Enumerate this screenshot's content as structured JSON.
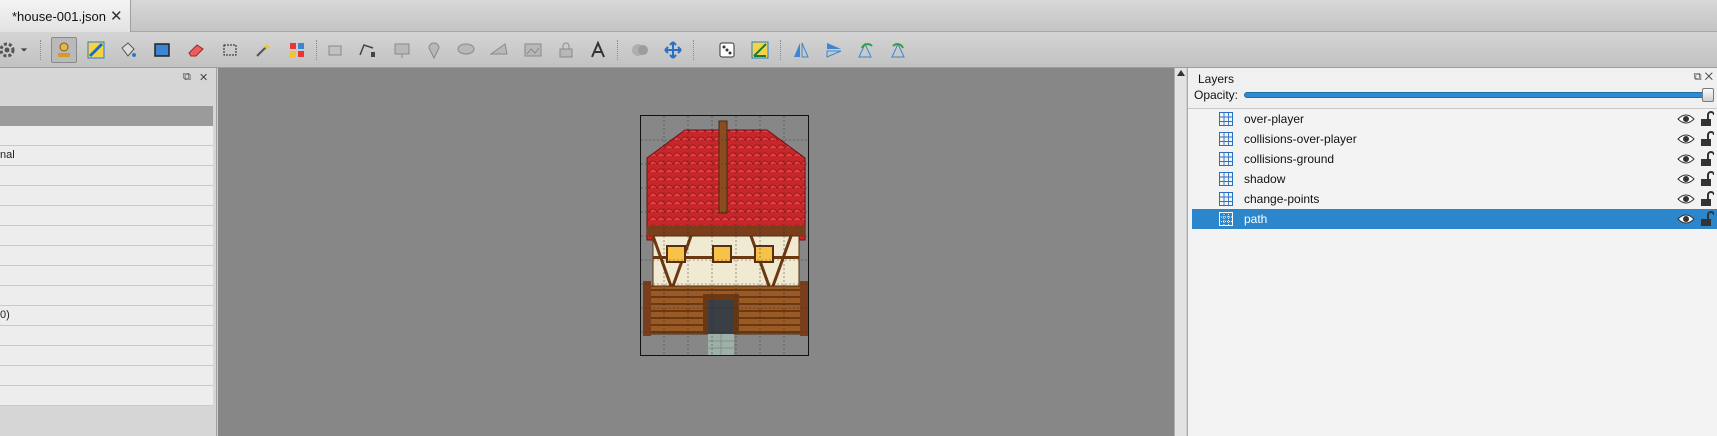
{
  "tabs": [
    {
      "label": "*house-001.json",
      "close": "✕"
    }
  ],
  "toolbar": {
    "tools": [
      "gear-icon",
      "stamp-brush-icon",
      "terrain-brush-icon",
      "bucket-fill-icon",
      "shape-fill-icon",
      "eraser-icon",
      "rect-select-icon",
      "magic-wand-icon",
      "select-same-tile-icon",
      "select-objects-icon",
      "edit-polygons-icon",
      "insert-rectangle-icon",
      "insert-point-icon",
      "insert-ellipse-icon",
      "insert-polygon-icon",
      "insert-tile-icon",
      "insert-template-icon",
      "insert-text-icon",
      "random-mode-icon",
      "wang-fill-icon",
      "dice-icon",
      "stamp-flip-icon",
      "flip-horizontal-icon",
      "flip-vertical-icon",
      "rotate-left-icon",
      "rotate-right-icon"
    ]
  },
  "left_panel": {
    "float_button": "⧉",
    "close_button": "✕",
    "rows": [
      "",
      "nal",
      "",
      "",
      "",
      "",
      "",
      "",
      "",
      "0)",
      "",
      "",
      "",
      ""
    ]
  },
  "layers_panel": {
    "title": "Layers",
    "float_button": "⧉",
    "close_button": "✕",
    "opacity_label": "Opacity:",
    "opacity": 1.0,
    "layers": [
      {
        "name": "over-player",
        "visible": true,
        "locked": false,
        "selected": false
      },
      {
        "name": "collisions-over-player",
        "visible": true,
        "locked": false,
        "selected": false
      },
      {
        "name": "collisions-ground",
        "visible": true,
        "locked": false,
        "selected": false
      },
      {
        "name": "shadow",
        "visible": true,
        "locked": false,
        "selected": false
      },
      {
        "name": "change-points",
        "visible": true,
        "locked": false,
        "selected": false
      },
      {
        "name": "path",
        "visible": true,
        "locked": false,
        "selected": true
      }
    ]
  },
  "colors": {
    "selection": "#2c86cb",
    "canvas_bg": "#878787",
    "roof": "#c8262a",
    "opacity_bar": "#2d8bd3"
  }
}
